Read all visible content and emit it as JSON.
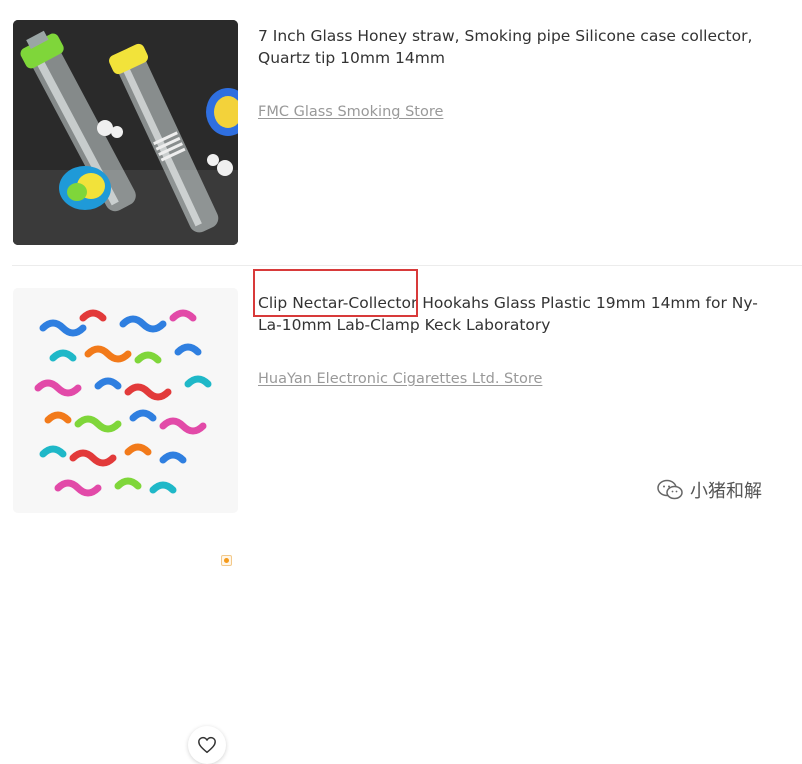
{
  "listings": [
    {
      "title": "7 Inch Glass Honey straw, Smoking pipe Silicone case collector, Quartz tip 10mm 14mm",
      "store": "FMC Glass Smoking Store",
      "image_icon": "product-photo"
    },
    {
      "title_highlight": "Clip Nectar-Collector",
      "title_rest": " Hookahs Glass Plastic 19mm 14mm for Ny-La-10mm Lab-Clamp Keck Laboratory",
      "store": "HuaYan Electronic Cigarettes Ltd. Store",
      "image_icon": "product-photo",
      "wishlist_icon": "heart-outline-icon",
      "ad_icon": "ad-badge-icon"
    }
  ],
  "watermark": {
    "text": "小猪和解",
    "icon": "wechat-logo-icon"
  },
  "colors": {
    "title": "#333333",
    "store_link": "#999999",
    "highlight_border": "#d83a3a",
    "divider": "#ececec"
  }
}
